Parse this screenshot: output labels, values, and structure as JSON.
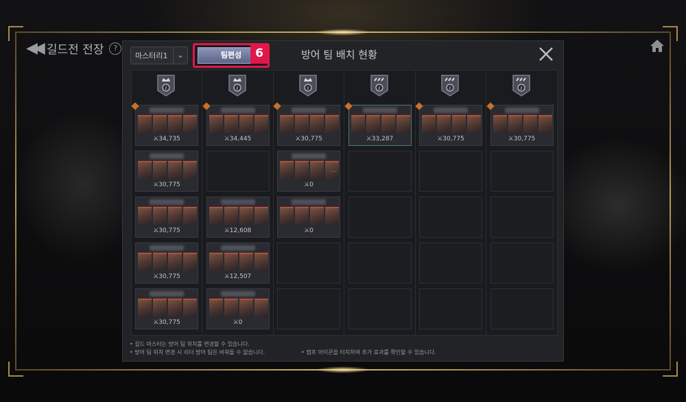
{
  "header": {
    "back_title": "길드전 전장",
    "help_glyph": "?"
  },
  "modal": {
    "select_value": "마스터리1",
    "team_edit_label": "팀편성",
    "step_badge": "6",
    "title": "방어 팀 배치 현황"
  },
  "columns": [
    {
      "camp_icon": "crown-camp-icon",
      "slots": [
        {
          "filled": true,
          "power": "34,735"
        },
        {
          "filled": true,
          "power": "30,775"
        },
        {
          "filled": true,
          "power": "30,775"
        },
        {
          "filled": true,
          "power": "30,775"
        },
        {
          "filled": true,
          "power": "30,775"
        }
      ]
    },
    {
      "camp_icon": "crown-camp-icon",
      "slots": [
        {
          "filled": true,
          "power": "34,445"
        },
        {
          "filled": false
        },
        {
          "filled": true,
          "power": "12,608"
        },
        {
          "filled": true,
          "power": "12,507"
        },
        {
          "filled": true,
          "power": "0"
        }
      ]
    },
    {
      "camp_icon": "crown-camp-icon",
      "slots": [
        {
          "filled": true,
          "power": "30,775"
        },
        {
          "filled": true,
          "power": "0",
          "more": "…"
        },
        {
          "filled": true,
          "power": "0"
        },
        {
          "filled": false
        },
        {
          "filled": false
        }
      ]
    },
    {
      "camp_icon": "claw-camp-icon",
      "slots": [
        {
          "filled": true,
          "power": "33,287",
          "highlight": true
        },
        {
          "filled": false
        },
        {
          "filled": false
        },
        {
          "filled": false
        },
        {
          "filled": false
        }
      ]
    },
    {
      "camp_icon": "claw-camp-icon",
      "slots": [
        {
          "filled": true,
          "power": "30,775"
        },
        {
          "filled": false
        },
        {
          "filled": false
        },
        {
          "filled": false
        },
        {
          "filled": false
        }
      ]
    },
    {
      "camp_icon": "claw-camp-icon",
      "slots": [
        {
          "filled": true,
          "power": "30,775"
        },
        {
          "filled": false
        },
        {
          "filled": false
        },
        {
          "filled": false
        },
        {
          "filled": false
        }
      ]
    }
  ],
  "notes": {
    "line1": "• 길드 마스터는 방어 팀 위치를 변경할 수 있습니다.",
    "line2": "• 방어 팀 위치 변경 시 리더 방어 팀은 비워둘 수 없습니다.",
    "line3": "• 캠프 아이콘을 터치하여 추가 효과를 확인할 수 있습니다."
  },
  "colors": {
    "accent_highlight": "#e0184a",
    "frame_gold": "#d8b86a"
  }
}
